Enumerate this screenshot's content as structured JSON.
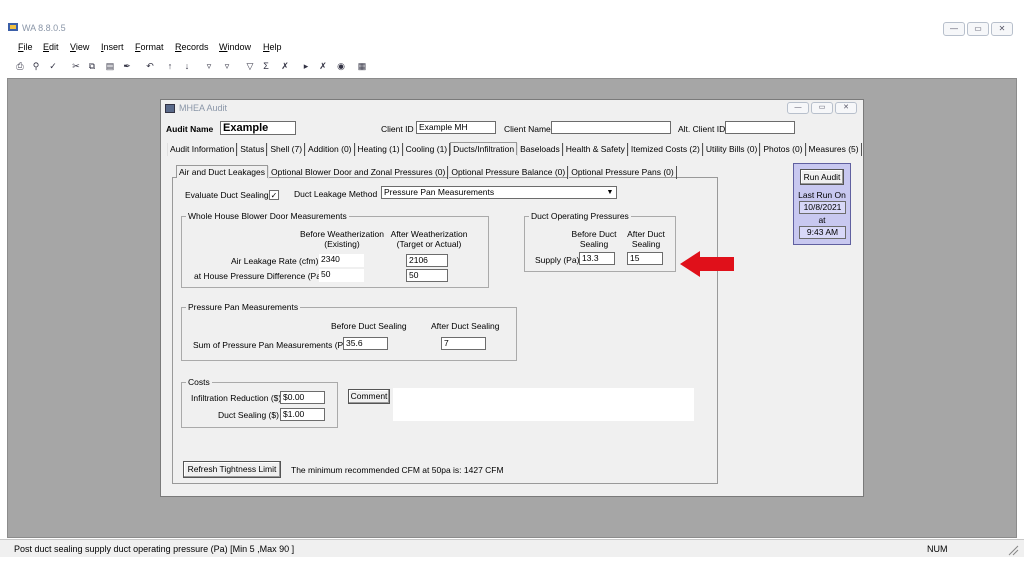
{
  "app": {
    "title": "WA 8.8.0.5"
  },
  "menu": [
    "File",
    "Edit",
    "View",
    "Insert",
    "Format",
    "Records",
    "Window",
    "Help"
  ],
  "dialog": {
    "title": "MHEA Audit",
    "audit_name_label": "Audit Name",
    "audit_name_value": "Example",
    "client_id_label": "Client ID",
    "client_id_value": "Example MH",
    "client_name_label": "Client Name",
    "client_name_value": "",
    "alt_client_id_label": "Alt. Client ID",
    "alt_client_id_value": "",
    "tabs": [
      "Audit Information",
      "Status",
      "Shell (7)",
      "Addition (0)",
      "Heating (1)",
      "Cooling (1)",
      "Ducts/Infiltration",
      "Baseloads",
      "Health & Safety",
      "Itemized Costs (2)",
      "Utility Bills (0)",
      "Photos (0)",
      "Measures (5)"
    ],
    "subtabs": [
      "Air and Duct Leakages",
      "Optional Blower Door and Zonal Pressures (0)",
      "Optional Pressure Balance (0)",
      "Optional Pressure Pans (0)"
    ],
    "evaluate_duct_sealing_label": "Evaluate Duct Sealing",
    "evaluate_duct_sealing_mark": "✓",
    "duct_leakage_method_label": "Duct Leakage Method",
    "duct_leakage_method_value": "Pressure Pan Measurements",
    "blower": {
      "title": "Whole House Blower Door Measurements",
      "before_header": "Before Weatherization (Existing)",
      "after_header": "After Weatherization (Target or Actual)",
      "air_leakage_label": "Air Leakage Rate (cfm)",
      "air_leakage_before": "2340",
      "air_leakage_after": "2106",
      "pressure_label": "at House Pressure Difference (Pa)",
      "pressure_before": "50",
      "pressure_after": "50"
    },
    "duct_pressures": {
      "title": "Duct Operating Pressures",
      "before_header": "Before Duct Sealing",
      "after_header": "After Duct Sealing",
      "supply_label": "Supply (Pa)",
      "supply_before": "13.3",
      "supply_after": "15"
    },
    "run_audit": {
      "button": "Run Audit",
      "last_run_label": "Last Run On",
      "date": "10/8/2021",
      "at": "at",
      "time": "9:43 AM"
    },
    "pan": {
      "title": "Pressure Pan Measurements",
      "before_header": "Before Duct Sealing",
      "after_header": "After Duct Sealing",
      "sum_label": "Sum of Pressure Pan Measurements (Pa)",
      "sum_before": "35.6",
      "sum_after": "7"
    },
    "costs": {
      "title": "Costs",
      "infiltration_label": "Infiltration Reduction ($)",
      "infiltration_value": "$0.00",
      "duct_label": "Duct Sealing ($)",
      "duct_value": "$1.00",
      "comment_button": "Comment"
    },
    "refresh_button": "Refresh Tightness Limit",
    "min_cfm_text": "The minimum recommended CFM at 50pa is: 1427 CFM"
  },
  "status": {
    "text": "Post duct sealing supply duct operating pressure (Pa) [Min 5 ,Max 90 ]",
    "num": "NUM"
  },
  "colors": {
    "arrow": "#e0101a",
    "workspace": "#a6a6a6",
    "run_panel": "#c8c8f0"
  }
}
